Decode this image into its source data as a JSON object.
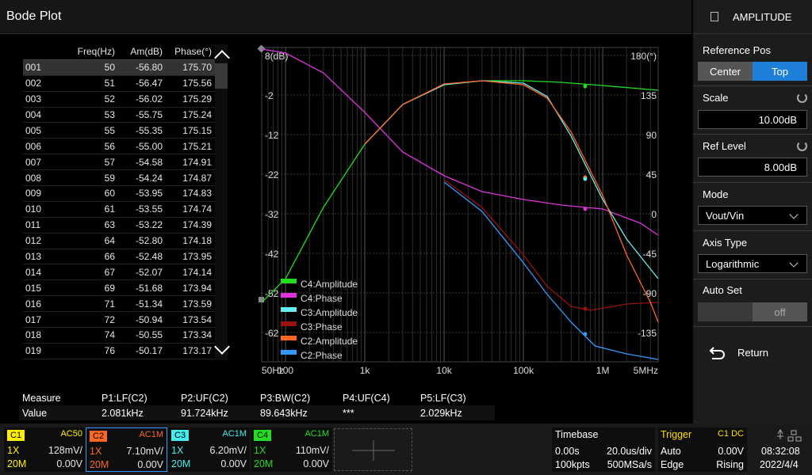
{
  "title": "Bode Plot",
  "panel": {
    "header": "AMPLITUDE",
    "ref_pos_label": "Reference Pos",
    "ref_pos_options": [
      "Center",
      "Top"
    ],
    "scale_label": "Scale",
    "scale_value": "10.00dB",
    "ref_level_label": "Ref Level",
    "ref_level_value": "8.00dB",
    "mode_label": "Mode",
    "mode_value": "Vout/Vin",
    "axis_label": "Axis Type",
    "axis_value": "Logarithmic",
    "autoset_label": "Auto Set",
    "autoset_value": "off",
    "return_label": "Return"
  },
  "table": {
    "headers": [
      "",
      "Freq(Hz)",
      "Am(dB)",
      "Phase(°)"
    ],
    "rows": [
      [
        "001",
        "50",
        "-56.80",
        "175.70"
      ],
      [
        "002",
        "51",
        "-56.47",
        "175.56"
      ],
      [
        "003",
        "52",
        "-56.02",
        "175.29"
      ],
      [
        "004",
        "53",
        "-55.75",
        "175.24"
      ],
      [
        "005",
        "55",
        "-55.35",
        "175.15"
      ],
      [
        "006",
        "56",
        "-55.00",
        "175.21"
      ],
      [
        "007",
        "57",
        "-54.58",
        "174.91"
      ],
      [
        "008",
        "59",
        "-54.24",
        "174.87"
      ],
      [
        "009",
        "60",
        "-53.95",
        "174.83"
      ],
      [
        "010",
        "61",
        "-53.55",
        "174.74"
      ],
      [
        "011",
        "63",
        "-53.22",
        "174.39"
      ],
      [
        "012",
        "64",
        "-52.80",
        "174.18"
      ],
      [
        "013",
        "66",
        "-52.48",
        "173.95"
      ],
      [
        "014",
        "67",
        "-52.07",
        "174.14"
      ],
      [
        "015",
        "69",
        "-51.68",
        "173.94"
      ],
      [
        "016",
        "71",
        "-51.34",
        "173.59"
      ],
      [
        "017",
        "72",
        "-50.94",
        "173.54"
      ],
      [
        "018",
        "74",
        "-50.55",
        "173.34"
      ],
      [
        "019",
        "76",
        "-50.17",
        "173.17"
      ]
    ]
  },
  "plot": {
    "y_left": [
      "8(dB)",
      "-2",
      "-12",
      "-22",
      "-32",
      "-42",
      "-52",
      "-62"
    ],
    "y_right": [
      "180(°)",
      "135",
      "90",
      "45",
      "0",
      "-45",
      "-90",
      "-135"
    ],
    "x_ticks": [
      "50Hz",
      "100",
      "1k",
      "10k",
      "100k",
      "1M",
      "5MHz"
    ],
    "legend": [
      {
        "name": "C4:Amplitude",
        "color": "#22dd22"
      },
      {
        "name": "C4:Phase",
        "color": "#dd33dd"
      },
      {
        "name": "C3:Amplitude",
        "color": "#66eeee"
      },
      {
        "name": "C3:Phase",
        "color": "#991111"
      },
      {
        "name": "C2:Amplitude",
        "color": "#ff6622"
      },
      {
        "name": "C2:Phase",
        "color": "#3399ff"
      }
    ]
  },
  "measure": {
    "label": "Measure",
    "value_label": "Value",
    "items": [
      {
        "name": "P1:LF(C2)",
        "value": "2.081kHz"
      },
      {
        "name": "P2:UF(C2)",
        "value": "91.724kHz"
      },
      {
        "name": "P3:BW(C2)",
        "value": "89.643kHz"
      },
      {
        "name": "P4:UF(C4)",
        "value": "***"
      },
      {
        "name": "P5:LF(C3)",
        "value": "2.029kHz"
      }
    ]
  },
  "channels": [
    {
      "id": "C1",
      "coupling": "AC50",
      "probe": "1X",
      "scale": "128mV/",
      "bw": "20M",
      "offset": "0.00V",
      "color": "#ffee00"
    },
    {
      "id": "C2",
      "coupling": "AC1M",
      "probe": "1X",
      "scale": "7.10mV/",
      "bw": "20M",
      "offset": "0.00V",
      "color": "#ff6622"
    },
    {
      "id": "C3",
      "coupling": "AC1M",
      "probe": "1X",
      "scale": "6.20mV/",
      "bw": "20M",
      "offset": "0.00V",
      "color": "#44eeee"
    },
    {
      "id": "C4",
      "coupling": "AC1M",
      "probe": "1X",
      "scale": "110mV/",
      "bw": "20M",
      "offset": "0.00V",
      "color": "#22dd22"
    }
  ],
  "timebase": {
    "label": "Timebase",
    "delay": "0.00s",
    "scale": "20.0us/div",
    "points": "100kpts",
    "rate": "500MSa/s"
  },
  "trigger": {
    "label": "Trigger",
    "source": "C1 DC",
    "mode": "Auto",
    "level": "0.00V",
    "type": "Edge",
    "slope": "Rising"
  },
  "clock": {
    "time": "08:32:08",
    "date": "2022/4/4"
  }
}
